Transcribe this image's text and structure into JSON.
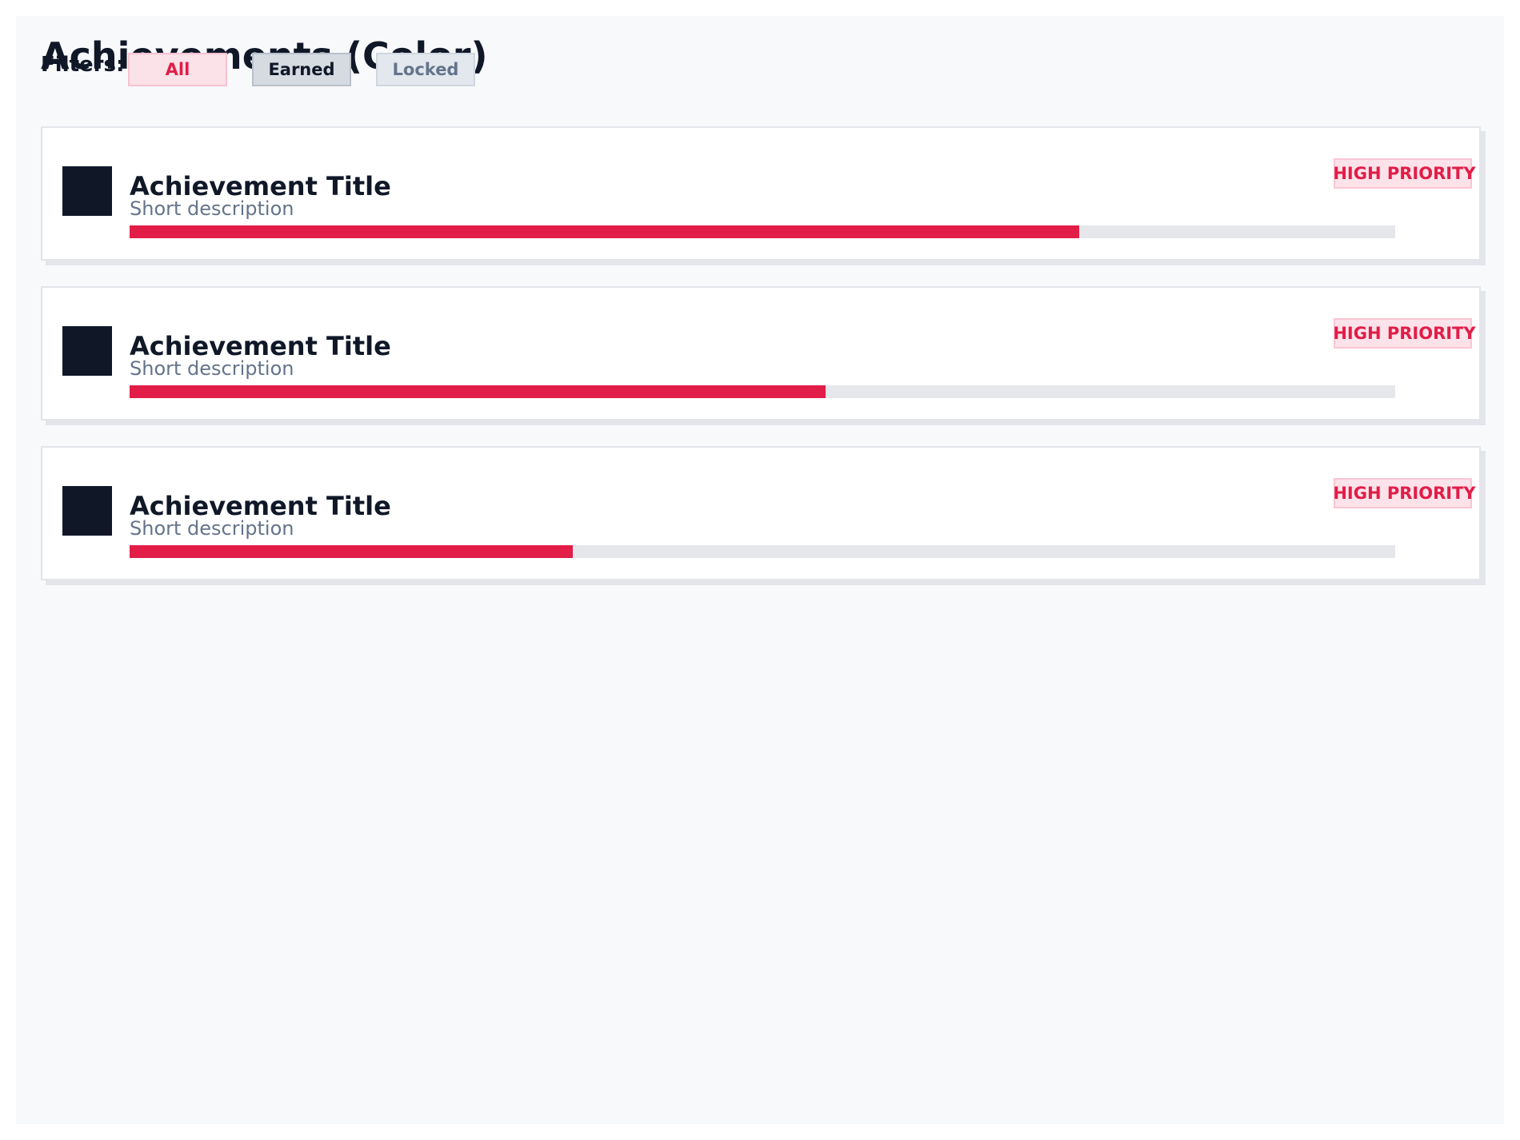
{
  "header": {
    "title": "Achievements (Color)",
    "filters_label": "Filters:"
  },
  "filters": [
    {
      "label": "All",
      "state": "active"
    },
    {
      "label": "Earned",
      "state": "default"
    },
    {
      "label": "Locked",
      "state": "default"
    }
  ],
  "colors": {
    "accent": "#e11d48",
    "text_primary": "#101828",
    "text_muted": "#64748b",
    "page_background": "#f8f9fb",
    "progress_track": "#e5e7eb"
  },
  "achievements": [
    {
      "title": "Achievement Title",
      "description": "Short description",
      "badge": "HIGH PRIORITY",
      "icon": "achievement-icon",
      "progress": 0.75
    },
    {
      "title": "Achievement Title",
      "description": "Short description",
      "badge": "HIGH PRIORITY",
      "icon": "achievement-icon",
      "progress": 0.55
    },
    {
      "title": "Achievement Title",
      "description": "Short description",
      "badge": "HIGH PRIORITY",
      "icon": "achievement-icon",
      "progress": 0.35
    }
  ]
}
